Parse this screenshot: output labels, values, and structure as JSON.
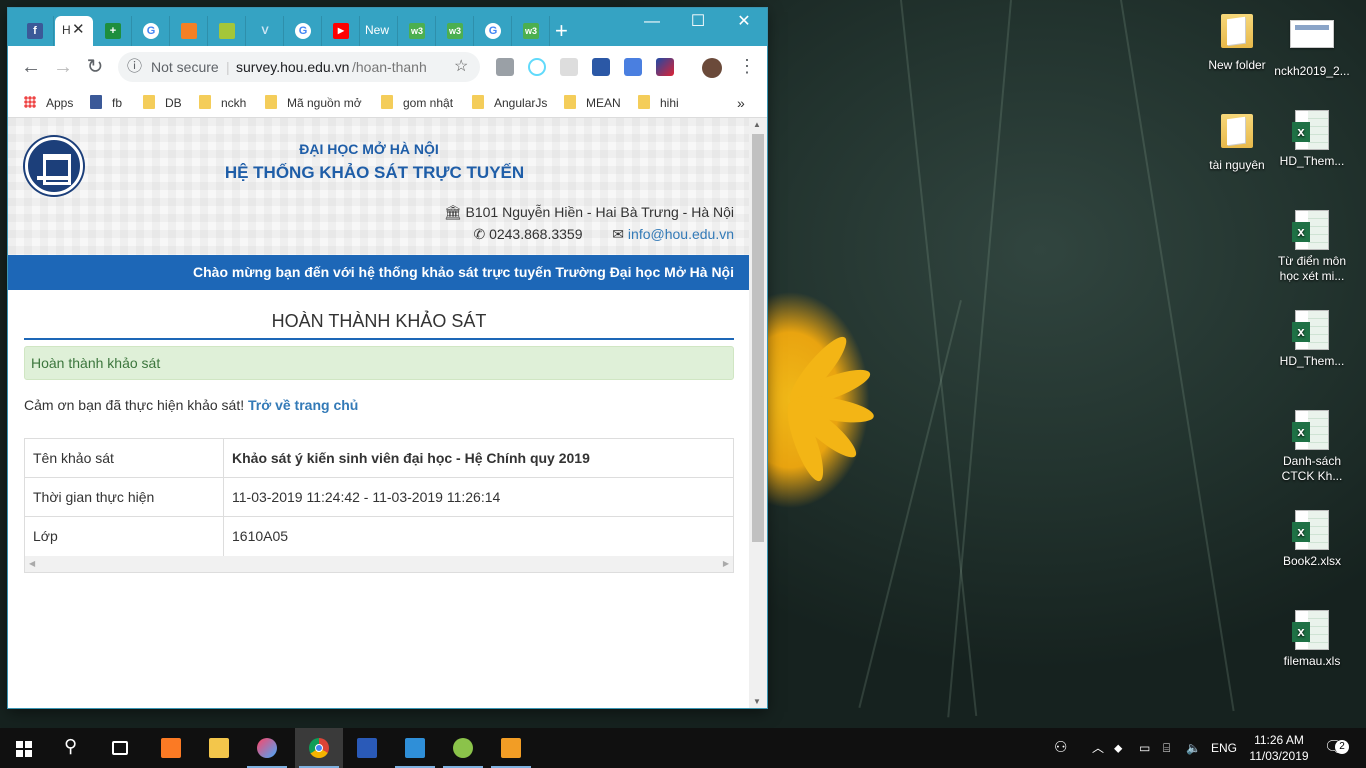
{
  "browser": {
    "active_tab_title": "H",
    "tabs": [
      {
        "icon": "facebook-icon",
        "color": "#3b5998",
        "glyph": "f"
      },
      {
        "icon": "plus-green-icon",
        "color": "#1e8e3e",
        "glyph": "+"
      },
      {
        "icon": "google-icon",
        "color": "#4285f4",
        "glyph": "G"
      },
      {
        "icon": "stack-icon",
        "color": "#f48024",
        "glyph": ""
      },
      {
        "icon": "android-icon",
        "color": "#a4c639",
        "glyph": ""
      },
      {
        "icon": "vuetify-icon",
        "color": "#7aa3c6",
        "glyph": "V"
      },
      {
        "icon": "google-icon",
        "color": "#4285f4",
        "glyph": "G"
      },
      {
        "icon": "youtube-icon",
        "color": "#ff0000",
        "glyph": "▶"
      },
      {
        "icon": "new-tab-icon",
        "color": "transparent",
        "glyph": "New"
      },
      {
        "icon": "w3schools-icon",
        "color": "#4caf50",
        "glyph": "w3"
      },
      {
        "icon": "w3schools-icon",
        "color": "#4caf50",
        "glyph": "w3"
      },
      {
        "icon": "google-icon",
        "color": "#4285f4",
        "glyph": "G"
      },
      {
        "icon": "w3schools-icon",
        "color": "#4caf50",
        "glyph": "w3"
      }
    ],
    "security": "Not secure",
    "url_host": "survey.hou.edu.vn",
    "url_path": "/hoan-thanh",
    "bookmarks": [
      "Apps",
      "fb",
      "DB",
      "nckh",
      "Mã nguồn mở",
      "gom nhật",
      "AngularJs",
      "MEAN",
      "hihi"
    ]
  },
  "page": {
    "university": "ĐẠI HỌC MỞ HÀ NỘI",
    "system": "HỆ THỐNG KHẢO SÁT TRỰC TUYẾN",
    "address": "B101 Nguyễn Hiền - Hai Bà Trưng - Hà Nội",
    "phone": "0243.868.3359",
    "email": "info@hou.edu.vn",
    "welcome": "Chào mừng bạn đến với hệ thống khảo sát trực tuyến Trường Đại học Mở Hà Nội",
    "heading": "HOÀN THÀNH KHẢO SÁT",
    "alert": "Hoàn thành khảo sát",
    "thanks": "Cảm ơn bạn đã thực hiện khảo sát!",
    "home_link": "Trở về trang chủ",
    "table": [
      {
        "label": "Tên khảo sát",
        "value": "Khảo sát ý kiến sinh viên đại học - Hệ Chính quy 2019"
      },
      {
        "label": "Thời gian thực hiện",
        "value": "11-03-2019 11:24:42 - 11-03-2019 11:26:14"
      },
      {
        "label": "Lớp",
        "value": "1610A05"
      }
    ]
  },
  "desktop": {
    "icons": [
      {
        "label": "New folder",
        "type": "folder"
      },
      {
        "label": "nckh2019_2...",
        "type": "doc"
      },
      {
        "label": "tài nguyên",
        "type": "folder"
      },
      {
        "label": "HD_Them...",
        "type": "xls"
      },
      {
        "label": "Từ điển môn học xét mi...",
        "type": "xls"
      },
      {
        "label": "HD_Them...",
        "type": "xls"
      },
      {
        "label": "Danh-sách CTCK Kh...",
        "type": "xls"
      },
      {
        "label": "Book2.xlsx",
        "type": "xls"
      },
      {
        "label": "filemau.xls",
        "type": "xls"
      }
    ]
  },
  "taskbar": {
    "language": "ENG",
    "time": "11:26 AM",
    "date": "11/03/2019",
    "notifications": "2"
  }
}
